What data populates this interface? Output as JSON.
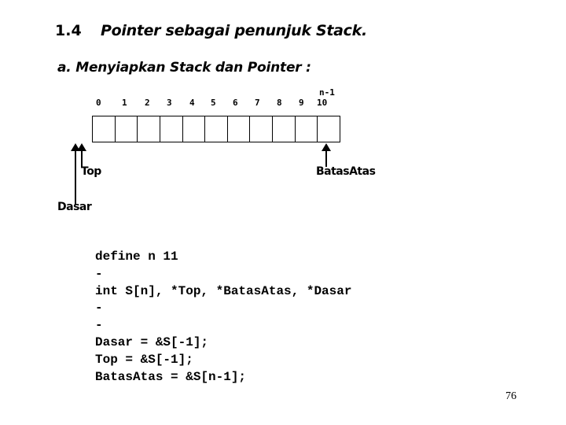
{
  "heading": {
    "number": "1.4",
    "title": "Pointer sebagai penunjuk Stack."
  },
  "subheading": "a. Menyiapkan Stack dan Pointer :",
  "stack_diagram": {
    "cell_count": 11,
    "indices": [
      "0",
      "1",
      "2",
      "3",
      "4",
      "5",
      "6",
      "7",
      "8",
      "9",
      "10"
    ],
    "last_index_annotation": "n-1",
    "pointers": {
      "top": "Top",
      "dasar": "Dasar",
      "batas_atas": "BatasAtas"
    }
  },
  "code": {
    "lines": [
      "define n 11",
      "-",
      "int S[n], *Top, *BatasAtas, *Dasar",
      "-",
      "-",
      "Dasar = &S[-1];",
      "Top = &S[-1];",
      "BatasAtas = &S[n-1];"
    ]
  },
  "page_number": "76"
}
